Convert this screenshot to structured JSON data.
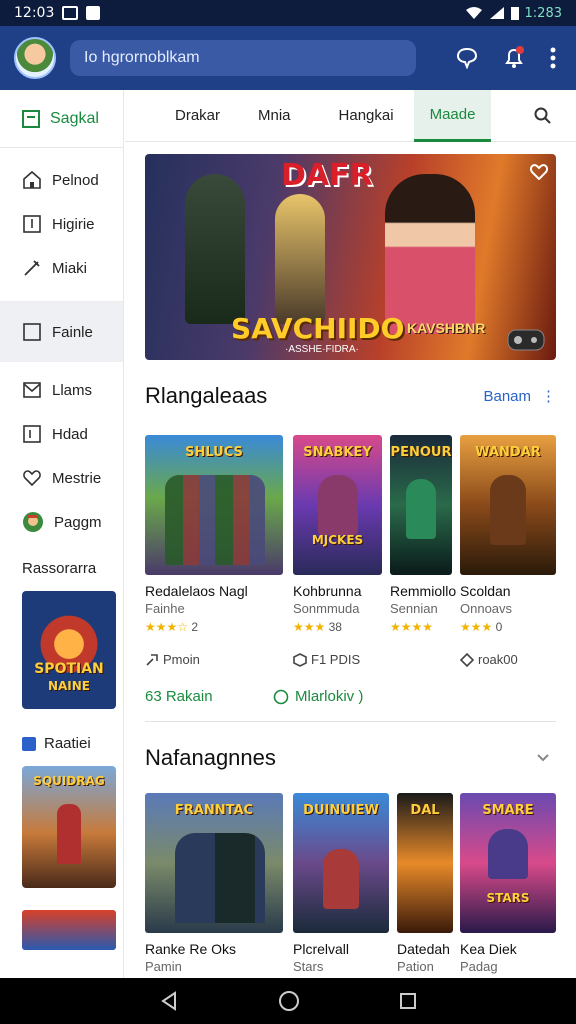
{
  "status": {
    "time": "12:03",
    "battery": "1:283"
  },
  "search": {
    "placeholder": "Io hgrornoblkam"
  },
  "sidebar": {
    "header": "Sagkal",
    "items": [
      {
        "label": "Pelnod",
        "icon": "home-icon"
      },
      {
        "label": "Higirie",
        "icon": "bookmark-icon"
      },
      {
        "label": "Miaki",
        "icon": "tools-icon"
      },
      {
        "label": "Fainle",
        "icon": "square-icon"
      },
      {
        "label": "Llams",
        "icon": "mail-icon"
      },
      {
        "label": "Hdad",
        "icon": "calendar-icon"
      },
      {
        "label": "Mestrie",
        "icon": "heart-icon"
      },
      {
        "label": "Paggm",
        "icon": "character-icon"
      }
    ],
    "subhead": "Rassorarra",
    "thumb1": {
      "top": "SPOTIAN",
      "bottom": "NAINE"
    },
    "link": "Raatiei",
    "thumb2": {
      "top": "SQUIDRAG"
    }
  },
  "tabs": [
    "Drakar",
    "Mnia",
    "Hangkai",
    "Maade"
  ],
  "hero": {
    "top_title": "DAFR",
    "title": "SAVCHIIDO",
    "subtitle": "KAVSHBNR",
    "tag": "·ASSHE·FIDRA·"
  },
  "section1": {
    "title": "Rlangaleaas",
    "more": "Banam",
    "cards": [
      {
        "art_top": "SHLUCS",
        "title": "Redalelaos Nagl",
        "sub": "Fainhe",
        "stars": "★★★☆",
        "rating": "2",
        "meta": "Pmoin"
      },
      {
        "art_top": "SNABKEY",
        "art_bottom": "MJCKES",
        "title": "Kohbrunna",
        "sub": "Sonmmuda",
        "stars": "★★★",
        "rating": "38",
        "meta": "F1 PDIS"
      },
      {
        "art_top": "PENOUR",
        "title": "Remmiollo",
        "sub": "Sennian",
        "stars": "★★★★",
        "rating": "",
        "meta": ""
      },
      {
        "art_top": "WANDAR",
        "title": "Scoldan",
        "sub": "Onnoavs",
        "stars": "★★★",
        "rating": "0",
        "meta": "roak00"
      }
    ],
    "action_left": "63 Rakain",
    "action_right": "Mlarlokiv )"
  },
  "section2": {
    "title": "Nafanagnnes",
    "cards": [
      {
        "art_top": "FRANNTAC",
        "title": "Ranke Re Oks",
        "sub": "Pamin"
      },
      {
        "art_top": "DUINUIEW",
        "title": "Plcrelvall",
        "sub": "Stars"
      },
      {
        "art_top": "DAL",
        "title": "Datedah",
        "sub": "Pation"
      },
      {
        "art_top": "SMARE",
        "art_bottom": "STARS",
        "title": "Kea Diek",
        "sub": "Padag"
      }
    ]
  }
}
